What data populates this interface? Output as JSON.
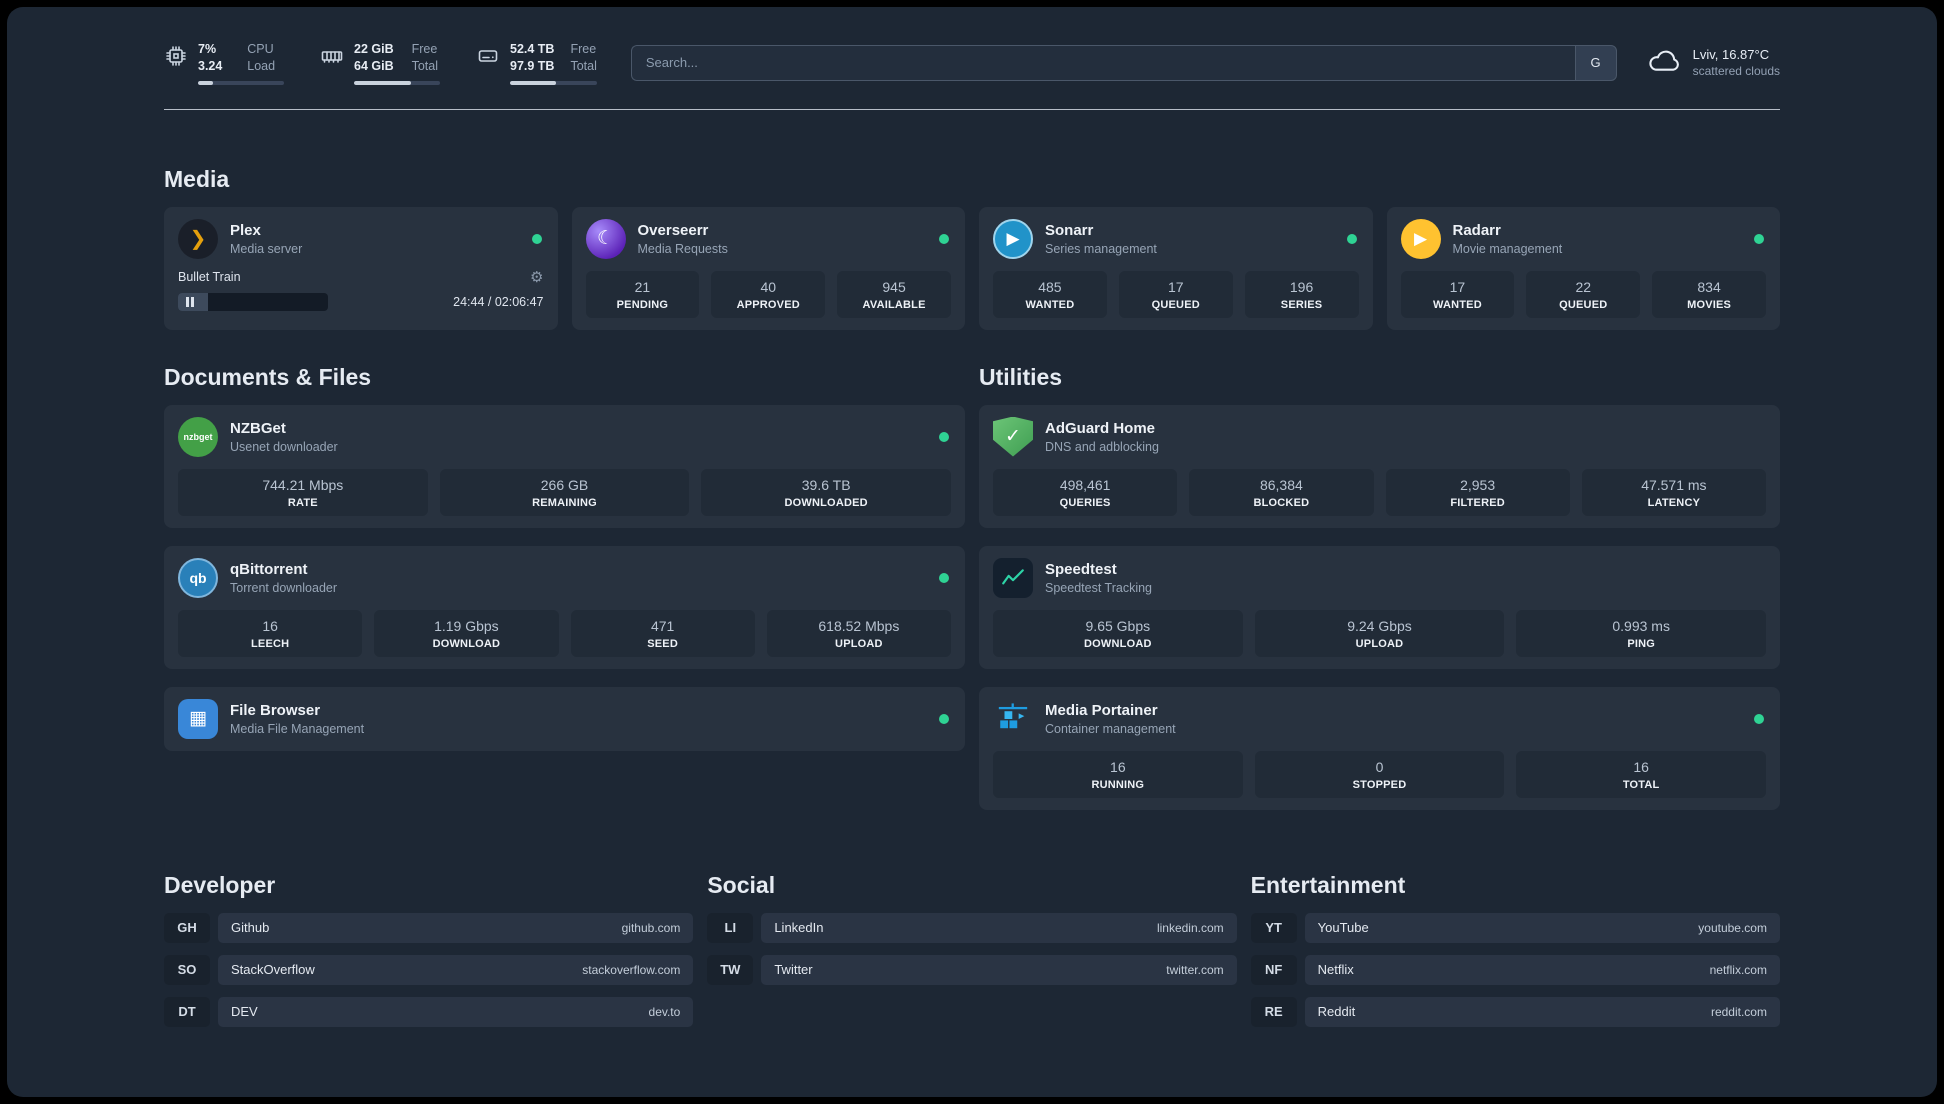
{
  "topbar": {
    "resources": [
      {
        "name": "cpu",
        "rows": [
          {
            "value": "7%",
            "label": "CPU"
          },
          {
            "value": "3.24",
            "label": "Load"
          }
        ],
        "progress_pct": 18
      },
      {
        "name": "memory",
        "rows": [
          {
            "value": "22 GiB",
            "label": "Free"
          },
          {
            "value": "64 GiB",
            "label": "Total"
          }
        ],
        "progress_pct": 66
      },
      {
        "name": "disk",
        "rows": [
          {
            "value": "52.4 TB",
            "label": "Free"
          },
          {
            "value": "97.9 TB",
            "label": "Total"
          }
        ],
        "progress_pct": 53
      }
    ],
    "search": {
      "placeholder": "Search...",
      "button_label": "G"
    },
    "weather": {
      "location": "Lviv, 16.87°C",
      "condition": "scattered clouds"
    }
  },
  "icons": {
    "plex": "❯",
    "overseerr": "☾",
    "sonarr": "▶",
    "radarr": "▶",
    "nzbget": "nzbget",
    "qbittorrent": "qb",
    "filebrowser": "▦",
    "adguard": "✓",
    "pause": "paused",
    "gear": "⚙"
  },
  "colors": {
    "background": "#1d2734",
    "card": "#28323f",
    "stat_tile": "#212b37",
    "status_online": "#2fd394",
    "plex_accent": "#e5a00d",
    "radarr_accent": "#ffc230",
    "sonarr_accent": "#2193c9",
    "adguard_green": "#4fae5e",
    "portainer_blue": "#1e9ce0"
  },
  "media": {
    "title": "Media",
    "plex": {
      "name": "Plex",
      "subtitle": "Media server",
      "now_playing": {
        "title": "Bullet Train",
        "time": "24:44 / 02:06:47",
        "progress_pct": 20
      }
    },
    "services": [
      {
        "name": "Overseerr",
        "subtitle": "Media Requests",
        "stats": [
          {
            "value": "21",
            "label": "PENDING"
          },
          {
            "value": "40",
            "label": "APPROVED"
          },
          {
            "value": "945",
            "label": "AVAILABLE"
          }
        ]
      },
      {
        "name": "Sonarr",
        "subtitle": "Series management",
        "stats": [
          {
            "value": "485",
            "label": "WANTED"
          },
          {
            "value": "17",
            "label": "QUEUED"
          },
          {
            "value": "196",
            "label": "SERIES"
          }
        ]
      },
      {
        "name": "Radarr",
        "subtitle": "Movie management",
        "stats": [
          {
            "value": "17",
            "label": "WANTED"
          },
          {
            "value": "22",
            "label": "QUEUED"
          },
          {
            "value": "834",
            "label": "MOVIES"
          }
        ]
      }
    ]
  },
  "documents": {
    "title": "Documents & Files",
    "services": [
      {
        "name": "NZBGet",
        "subtitle": "Usenet downloader",
        "stats": [
          {
            "value": "744.21 Mbps",
            "label": "RATE"
          },
          {
            "value": "266 GB",
            "label": "REMAINING"
          },
          {
            "value": "39.6 TB",
            "label": "DOWNLOADED"
          }
        ]
      },
      {
        "name": "qBittorrent",
        "subtitle": "Torrent downloader",
        "stats": [
          {
            "value": "16",
            "label": "LEECH"
          },
          {
            "value": "1.19 Gbps",
            "label": "DOWNLOAD"
          },
          {
            "value": "471",
            "label": "SEED"
          },
          {
            "value": "618.52 Mbps",
            "label": "UPLOAD"
          }
        ]
      },
      {
        "name": "File Browser",
        "subtitle": "Media File Management",
        "stats": []
      }
    ]
  },
  "utilities": {
    "title": "Utilities",
    "services": [
      {
        "name": "AdGuard Home",
        "subtitle": "DNS and adblocking",
        "stats": [
          {
            "value": "498,461",
            "label": "QUERIES"
          },
          {
            "value": "86,384",
            "label": "BLOCKED"
          },
          {
            "value": "2,953",
            "label": "FILTERED"
          },
          {
            "value": "47.571 ms",
            "label": "LATENCY"
          }
        ]
      },
      {
        "name": "Speedtest",
        "subtitle": "Speedtest Tracking",
        "stats": [
          {
            "value": "9.65 Gbps",
            "label": "DOWNLOAD"
          },
          {
            "value": "9.24 Gbps",
            "label": "UPLOAD"
          },
          {
            "value": "0.993 ms",
            "label": "PING"
          }
        ]
      },
      {
        "name": "Media Portainer",
        "subtitle": "Container management",
        "stats": [
          {
            "value": "16",
            "label": "RUNNING"
          },
          {
            "value": "0",
            "label": "STOPPED"
          },
          {
            "value": "16",
            "label": "TOTAL"
          }
        ]
      }
    ]
  },
  "bookmarks": {
    "groups": [
      {
        "title": "Developer",
        "items": [
          {
            "abbr": "GH",
            "name": "Github",
            "url": "github.com"
          },
          {
            "abbr": "SO",
            "name": "StackOverflow",
            "url": "stackoverflow.com"
          },
          {
            "abbr": "DT",
            "name": "DEV",
            "url": "dev.to"
          }
        ]
      },
      {
        "title": "Social",
        "items": [
          {
            "abbr": "LI",
            "name": "LinkedIn",
            "url": "linkedin.com"
          },
          {
            "abbr": "TW",
            "name": "Twitter",
            "url": "twitter.com"
          }
        ]
      },
      {
        "title": "Entertainment",
        "items": [
          {
            "abbr": "YT",
            "name": "YouTube",
            "url": "youtube.com"
          },
          {
            "abbr": "NF",
            "name": "Netflix",
            "url": "netflix.com"
          },
          {
            "abbr": "RE",
            "name": "Reddit",
            "url": "reddit.com"
          }
        ]
      }
    ]
  }
}
